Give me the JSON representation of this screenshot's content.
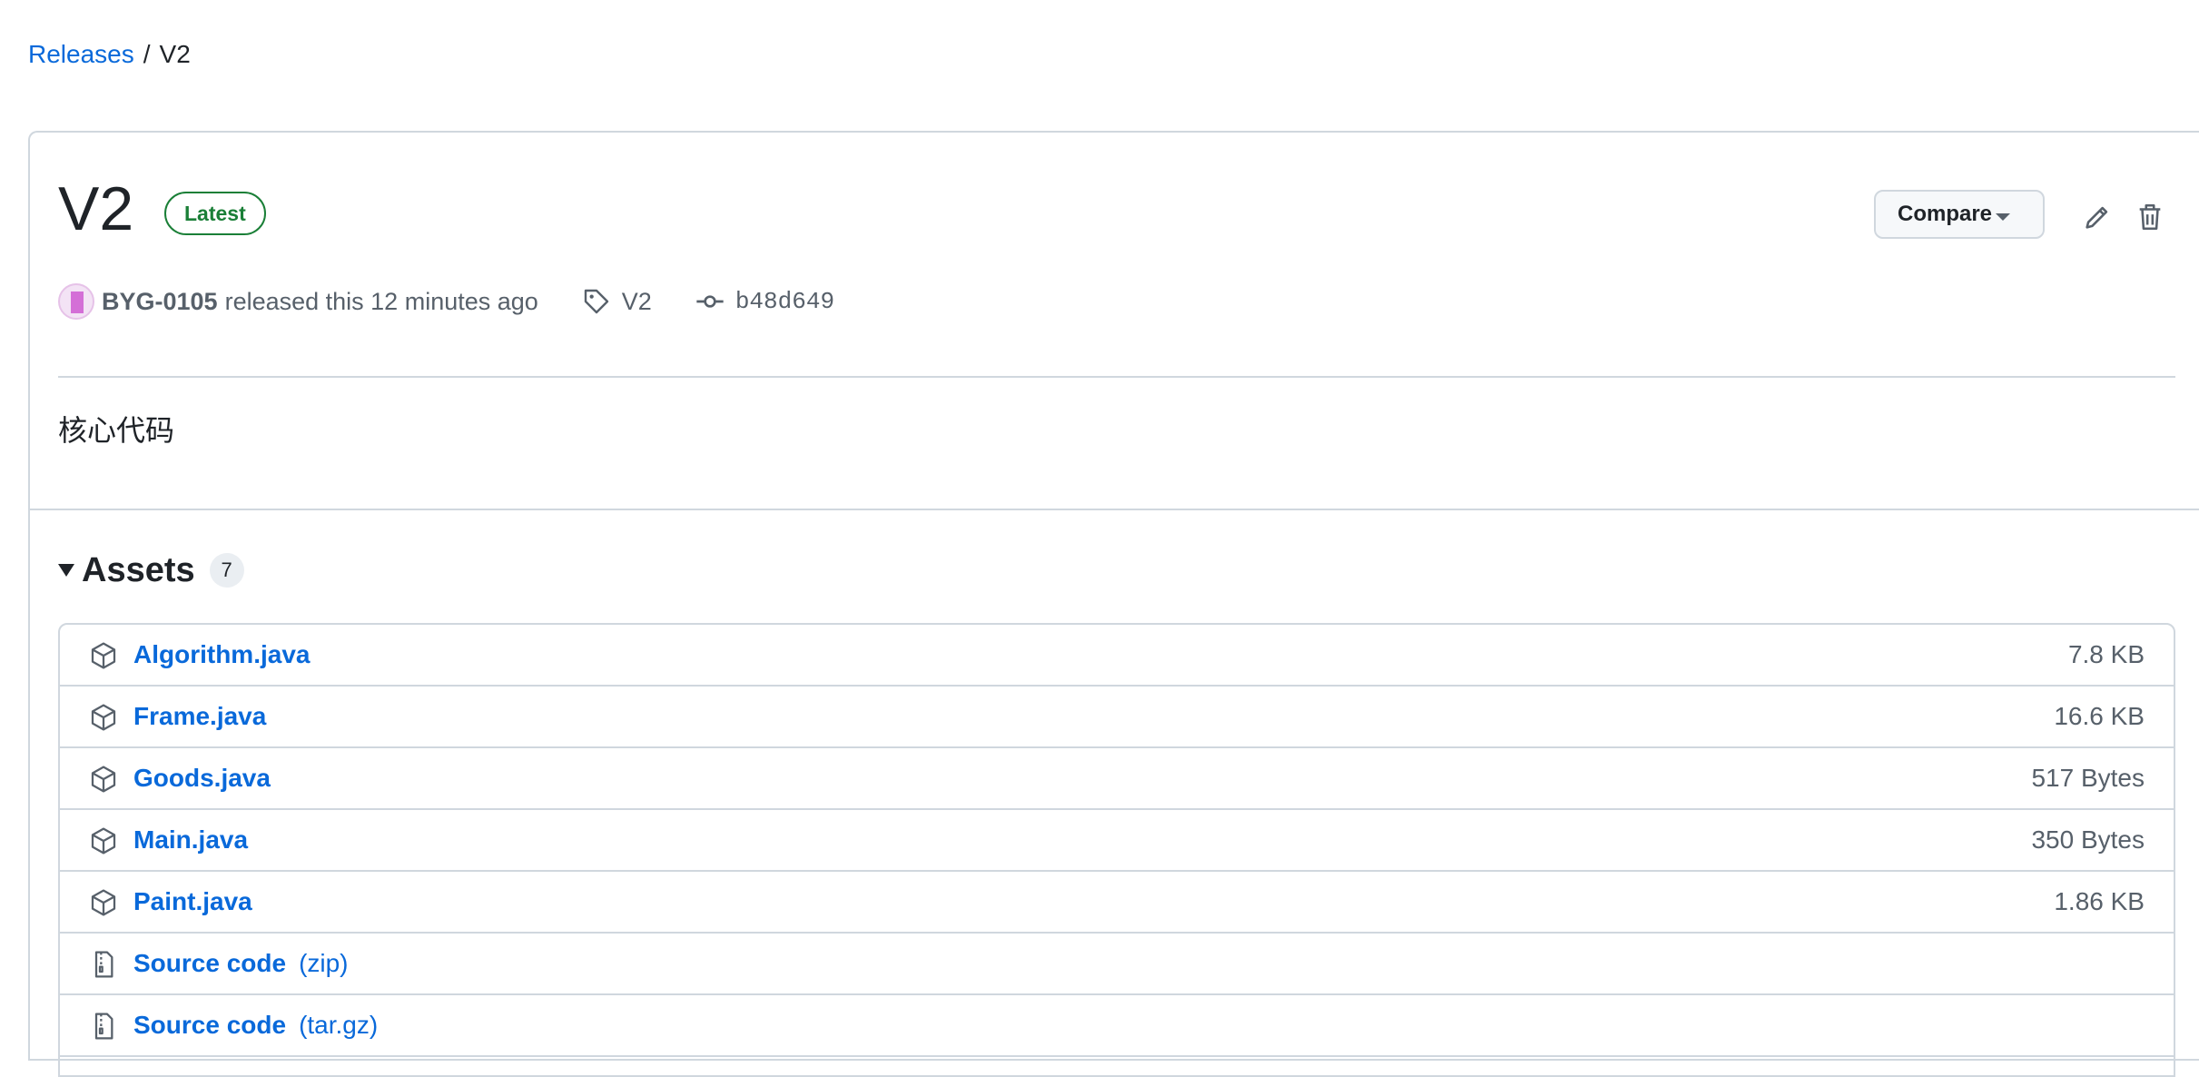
{
  "breadcrumb": {
    "root": "Releases",
    "separator": "/",
    "current": "V2"
  },
  "release": {
    "title": "V2",
    "badge": "Latest",
    "compare_label": "Compare",
    "author": "BYG-0105",
    "released_text": "released this 12 minutes ago",
    "tag": "V2",
    "commit": "b48d649",
    "body": "核心代码"
  },
  "assets": {
    "title": "Assets",
    "count": "7",
    "items": [
      {
        "name": "Algorithm.java",
        "suffix": "",
        "size": "7.8 KB",
        "icon": "package-icon"
      },
      {
        "name": "Frame.java",
        "suffix": "",
        "size": "16.6 KB",
        "icon": "package-icon"
      },
      {
        "name": "Goods.java",
        "suffix": "",
        "size": "517 Bytes",
        "icon": "package-icon"
      },
      {
        "name": "Main.java",
        "suffix": "",
        "size": "350 Bytes",
        "icon": "package-icon"
      },
      {
        "name": "Paint.java",
        "suffix": "",
        "size": "1.86 KB",
        "icon": "package-icon"
      },
      {
        "name": "Source code",
        "suffix": "(zip)",
        "size": "",
        "icon": "file-zip-icon"
      },
      {
        "name": "Source code",
        "suffix": "(tar.gz)",
        "size": "",
        "icon": "file-zip-icon"
      }
    ]
  },
  "colors": {
    "link": "#0969da",
    "success": "#1a7f37",
    "border": "#d0d7de",
    "muted": "#57606a"
  }
}
